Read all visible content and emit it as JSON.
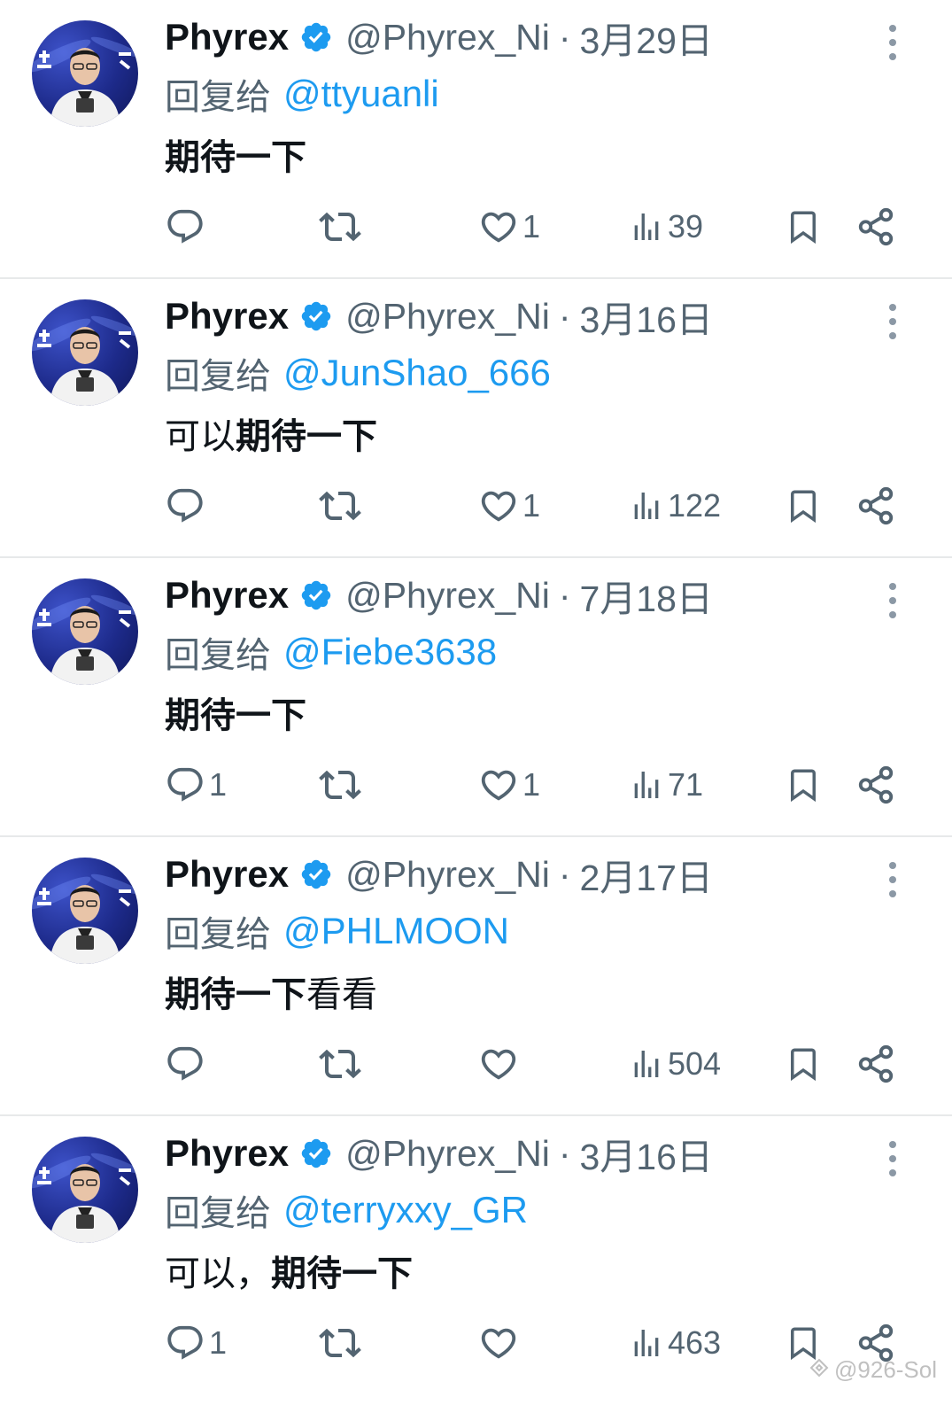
{
  "colors": {
    "link": "#1d9bf0",
    "secondary_text": "#536471",
    "primary_text": "#0f1419",
    "verified_badge": "#1d9bf0"
  },
  "tweets": [
    {
      "display_name": "Phyrex",
      "handle": "@Phyrex_Ni",
      "separator": "·",
      "date": "3月29日",
      "reply_prefix": "回复给",
      "reply_target": "@ttyuanli",
      "text_bold": "期待一下",
      "text_normal": "",
      "reply_count": "",
      "retweet_count": "",
      "like_count": "1",
      "view_count": "39",
      "liked_icon": "heart-outline-icon"
    },
    {
      "display_name": "Phyrex",
      "handle": "@Phyrex_Ni",
      "separator": "·",
      "date": "3月16日",
      "reply_prefix": "回复给",
      "reply_target": "@JunShao_666",
      "text_normal_pre": "可以",
      "text_bold": "期待一下",
      "text_normal": "",
      "reply_count": "",
      "retweet_count": "",
      "like_count": "1",
      "view_count": "122"
    },
    {
      "display_name": "Phyrex",
      "handle": "@Phyrex_Ni",
      "separator": "·",
      "date": "7月18日",
      "reply_prefix": "回复给",
      "reply_target": "@Fiebe3638",
      "text_bold": "期待一下",
      "text_normal": "",
      "reply_count": "1",
      "retweet_count": "",
      "like_count": "1",
      "view_count": "71"
    },
    {
      "display_name": "Phyrex",
      "handle": "@Phyrex_Ni",
      "separator": "·",
      "date": "2月17日",
      "reply_prefix": "回复给",
      "reply_target": "@PHLMOON",
      "text_bold": "期待一下",
      "text_normal": "看看",
      "reply_count": "",
      "retweet_count": "",
      "like_count": "",
      "view_count": "504"
    },
    {
      "display_name": "Phyrex",
      "handle": "@Phyrex_Ni",
      "separator": "·",
      "date": "3月16日",
      "reply_prefix": "回复给",
      "reply_target": "@terryxxy_GR",
      "text_normal_pre": "可以，",
      "text_bold": "期待一下",
      "text_normal": "",
      "reply_count": "1",
      "retweet_count": "",
      "like_count": "",
      "view_count": "463"
    }
  ],
  "watermark": "@926-Sol"
}
